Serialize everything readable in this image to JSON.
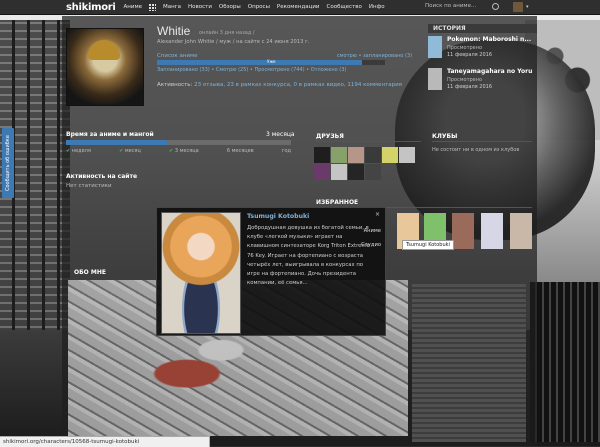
{
  "topbar": {
    "logo": "shikimori",
    "nav": [
      "Аниме",
      "Манга",
      "Новости",
      "Обзоры",
      "Опросы",
      "Рекомендации",
      "Сообщество",
      "Инфо"
    ],
    "search_placeholder": "Поиск по аниме..."
  },
  "profile": {
    "name": "Whitie",
    "status": "онлайн 3 дня назад /",
    "status_flag": "",
    "meta": "Alexander John Whitie  /  муж  /  на сайте с 24 июня 2013 г.",
    "list_title": "Список аниме",
    "list_sub": "смотрю  •  запланировано (3)",
    "list_bar_label": "Уже",
    "list_fill": 0.9,
    "list_stats": "Запланировано (33)   •   Смотрю (25)   •   Просмотрено (744)   •   Отложено (3)",
    "activity_label": "Активность:",
    "activity_value": "23 отзыва, 23 в рамках конкурса, 0 в рамках видео, 1194 комментария"
  },
  "history": {
    "title": "ИСТОРИЯ",
    "items": [
      {
        "title": "Pokemon: Maboroshi n...",
        "sub": "Просмотрено",
        "date": "11 февраля 2016"
      },
      {
        "title": "Taneyamagahara no Yoru",
        "sub": "Просмотрено",
        "date": "11 февраля 2016"
      }
    ]
  },
  "time": {
    "label": "Время за аниме и мангой",
    "period": "3 месяца",
    "marks": [
      "неделя",
      "месяц",
      "3 месяца",
      "6 месяцев",
      "год"
    ],
    "fill": 0.45
  },
  "activity": {
    "title": "Активность на сайте",
    "none": "Нет статистики"
  },
  "friends": {
    "title": "ДРУЗЬЯ"
  },
  "clubs": {
    "title": "КЛУБЫ",
    "none": "Не состоит ни в одном из клубов"
  },
  "favourites": {
    "title": "ИЗБРАННОЕ",
    "tab_anime": "Аниме",
    "tab_studio": "Студио"
  },
  "about": {
    "title": "ОБО МНЕ"
  },
  "popup": {
    "name": "Tsumugi Kotobuki",
    "description": "Добродушная девушка из богатой семьи, в клубе «легкой музыки» играет на клавишном синтезаторе Korg Triton Extreme 76 Key. Играет на фортепиано с возраста четырёх лет, выигрывала в конкурсах по игре на фортепиано. Дочь президента компании, её семья...",
    "tab1": "Аниме",
    "tab2": "Студио"
  },
  "tooltip_label": "Tsumugi Kotobuki",
  "feedback_label": "Сообщить об ошибке",
  "statusbar": "shikimori.org/characters/10568-tsumugi-kotobuki",
  "colors": {
    "accent": "#3d79b3",
    "link": "#7fb3d9",
    "topbar": "#2f2f2f"
  }
}
